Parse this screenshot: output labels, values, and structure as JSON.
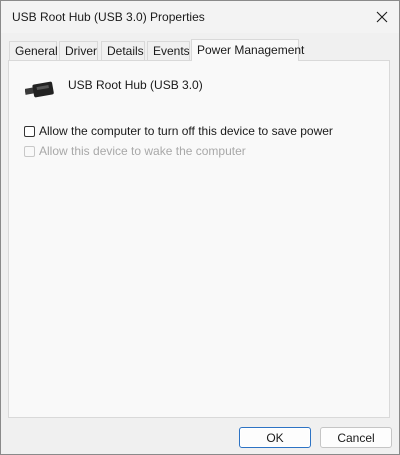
{
  "window": {
    "title": "USB Root Hub (USB 3.0) Properties"
  },
  "tabs": [
    {
      "label": "General"
    },
    {
      "label": "Driver"
    },
    {
      "label": "Details"
    },
    {
      "label": "Events"
    },
    {
      "label": "Power Management",
      "active": true
    }
  ],
  "device": {
    "name": "USB Root Hub (USB 3.0)",
    "icon": "usb-cable-icon"
  },
  "options": {
    "allow_turn_off": {
      "label": "Allow the computer to turn off this device to save power",
      "checked": false,
      "enabled": true
    },
    "allow_wake": {
      "label": "Allow this device to wake the computer",
      "checked": false,
      "enabled": false
    }
  },
  "buttons": {
    "ok": "OK",
    "cancel": "Cancel"
  },
  "colors": {
    "accent": "#2d73c4",
    "disabled_text": "#a8a8a8"
  }
}
